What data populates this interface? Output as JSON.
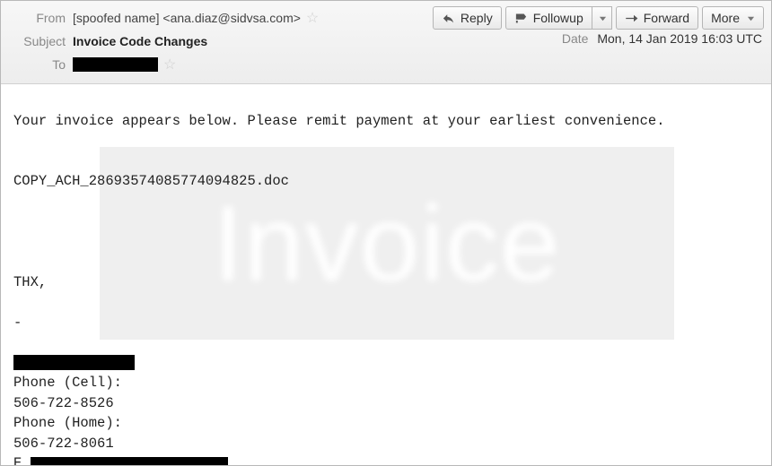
{
  "header": {
    "labels": {
      "from": "From",
      "subject": "Subject",
      "to": "To",
      "date": "Date"
    },
    "from": "[spoofed name] <ana.diaz@sidvsa.com>",
    "subject": "Invoice Code Changes",
    "date": "Mon, 14 Jan 2019 16:03 UTC"
  },
  "toolbar": {
    "reply": "Reply",
    "followup": "Followup",
    "forward": "Forward",
    "more": "More"
  },
  "body": {
    "line1": "Your invoice appears below. Please remit payment at your earliest convenience.",
    "attachment": "COPY_ACH_28693574085774094825.doc",
    "thx": "THX,",
    "dash": "-",
    "phone_cell_label": "Phone (Cell):",
    "phone_cell": "506-722-8526",
    "phone_home_label": "Phone (Home):",
    "phone_home": "506-722-8061",
    "email_label_prefix": "E",
    "watermark": "Invoice"
  }
}
